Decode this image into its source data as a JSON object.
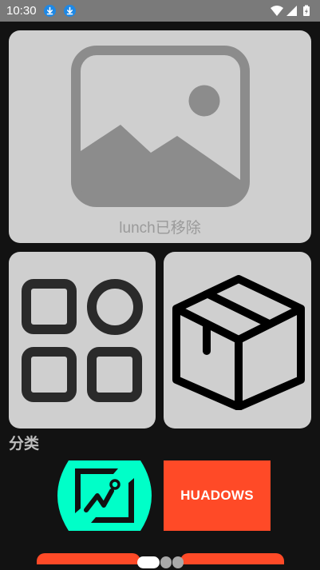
{
  "status_bar": {
    "time": "10:30",
    "icons": [
      "download-icon",
      "download-icon",
      "wifi-icon",
      "signal-icon",
      "battery-icon"
    ],
    "download_color": "#1e88e5"
  },
  "hero_card": {
    "icon": "image-placeholder-icon",
    "label": "lunch已移除"
  },
  "tiles": [
    {
      "icon": "categories-grid-icon"
    },
    {
      "icon": "package-box-icon"
    }
  ],
  "section": {
    "title": "分类"
  },
  "apps": [
    {
      "icon": "gallery-app-icon",
      "color": "#00ffc8"
    },
    {
      "label": "HUADOWS",
      "color": "#ff4a27"
    }
  ],
  "pager": {
    "count": 3,
    "active_index": 0
  },
  "colors": {
    "background": "#121212",
    "card": "#cfcfcf",
    "accent_orange": "#ff4a27"
  }
}
